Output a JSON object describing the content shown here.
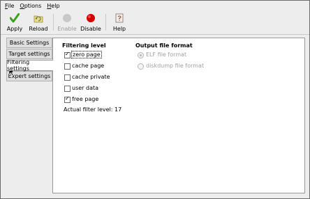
{
  "menubar": {
    "items": [
      {
        "mnemonic": "F",
        "rest": "ile"
      },
      {
        "mnemonic": "O",
        "rest": "ptions"
      },
      {
        "mnemonic": "H",
        "rest": "elp"
      }
    ]
  },
  "toolbar": {
    "apply_label": "Apply",
    "reload_label": "Reload",
    "enable_label": "Enable",
    "disable_label": "Disable",
    "help_label": "Help"
  },
  "tabs": {
    "basic": "Basic Settings",
    "target": "Target settings",
    "filtering": "Filtering settings",
    "expert": "Expert settings",
    "active": "filtering"
  },
  "filtering": {
    "heading": "Filtering level",
    "options": [
      {
        "label": "zero page",
        "checked": true
      },
      {
        "label": "cache page",
        "checked": false
      },
      {
        "label": "cache private",
        "checked": false
      },
      {
        "label": "user data",
        "checked": false
      },
      {
        "label": "free page",
        "checked": true
      }
    ],
    "actual_level": "Actual filter level: 17"
  },
  "output_format": {
    "heading": "Output file format",
    "options": [
      {
        "label": "ELF file format",
        "selected": true
      },
      {
        "label": "diskdump file format",
        "selected": false
      }
    ]
  },
  "colors": {
    "apply_icon": "#3aa01e",
    "disable_icon": "#d40000",
    "enable_icon_disabled": "#c8c8c8",
    "disabled_text": "#a0a0a0"
  }
}
